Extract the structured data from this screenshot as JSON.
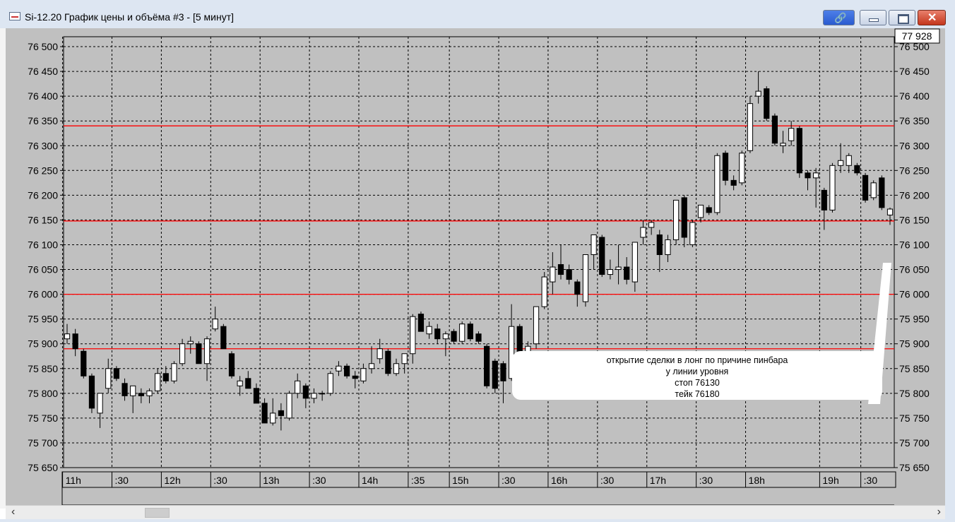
{
  "window": {
    "title": "Si-12.20 График цены и объёма #3 - [5 минут]"
  },
  "price_box": "77 928",
  "annotation": {
    "lines": [
      "открытие сделки в лонг по причине пинбара",
      "у линии уровня",
      "стоп  76130",
      "тейк 76180"
    ]
  },
  "colors": {
    "background": "#c0c0c0",
    "grid": "#000000",
    "level_line": "#ff0000",
    "bull_candle": "#ffffff",
    "bear_candle": "#000000"
  },
  "chart_data": {
    "type": "candlestick",
    "ylim": [
      75650,
      76520
    ],
    "yticks": [
      75650,
      75700,
      75750,
      75800,
      75850,
      75900,
      75950,
      76000,
      76050,
      76100,
      76150,
      76200,
      76250,
      76300,
      76350,
      76400,
      76450,
      76500
    ],
    "ytick_labels": [
      "75 650",
      "75 700",
      "75 750",
      "75 800",
      "75 850",
      "75 900",
      "75 950",
      "76 000",
      "76 050",
      "76 100",
      "76 150",
      "76 200",
      "76 250",
      "76 300",
      "76 350",
      "76 400",
      "76 450",
      "76 500"
    ],
    "time_labels": [
      "11h",
      ":30",
      "12h",
      ":30",
      "13h",
      ":30",
      "14h",
      ":35",
      "15h",
      ":30",
      "16h",
      ":30",
      "17h",
      ":30",
      "18h",
      "19h",
      ":30"
    ],
    "time_label_slots": [
      0,
      6,
      12,
      18,
      24,
      30,
      36,
      42,
      47,
      53,
      59,
      65,
      71,
      77,
      83,
      92,
      97
    ],
    "grid": true,
    "horizontal_levels": [
      76340,
      76148,
      76000,
      75890
    ],
    "candles": [
      {
        "o": 75910,
        "h": 75940,
        "l": 75900,
        "c": 75920
      },
      {
        "o": 75920,
        "h": 75930,
        "l": 75875,
        "c": 75890
      },
      {
        "o": 75885,
        "h": 75890,
        "l": 75830,
        "c": 75835
      },
      {
        "o": 75835,
        "h": 75840,
        "l": 75760,
        "c": 75770
      },
      {
        "o": 75760,
        "h": 75800,
        "l": 75730,
        "c": 75800
      },
      {
        "o": 75810,
        "h": 75870,
        "l": 75800,
        "c": 75850
      },
      {
        "o": 75850,
        "h": 75855,
        "l": 75825,
        "c": 75830
      },
      {
        "o": 75820,
        "h": 75830,
        "l": 75785,
        "c": 75795
      },
      {
        "o": 75795,
        "h": 75815,
        "l": 75760,
        "c": 75815
      },
      {
        "o": 75800,
        "h": 75810,
        "l": 75780,
        "c": 75795
      },
      {
        "o": 75795,
        "h": 75810,
        "l": 75780,
        "c": 75805
      },
      {
        "o": 75805,
        "h": 75850,
        "l": 75800,
        "c": 75840
      },
      {
        "o": 75840,
        "h": 75855,
        "l": 75820,
        "c": 75825
      },
      {
        "o": 75825,
        "h": 75865,
        "l": 75820,
        "c": 75860
      },
      {
        "o": 75860,
        "h": 75910,
        "l": 75855,
        "c": 75900
      },
      {
        "o": 75900,
        "h": 75915,
        "l": 75880,
        "c": 75905
      },
      {
        "o": 75900,
        "h": 75905,
        "l": 75860,
        "c": 75860
      },
      {
        "o": 75860,
        "h": 75915,
        "l": 75825,
        "c": 75910
      },
      {
        "o": 75930,
        "h": 75975,
        "l": 75925,
        "c": 75950
      },
      {
        "o": 75935,
        "h": 75940,
        "l": 75890,
        "c": 75890
      },
      {
        "o": 75880,
        "h": 75885,
        "l": 75830,
        "c": 75835
      },
      {
        "o": 75815,
        "h": 75835,
        "l": 75795,
        "c": 75825
      },
      {
        "o": 75830,
        "h": 75845,
        "l": 75810,
        "c": 75810
      },
      {
        "o": 75810,
        "h": 75820,
        "l": 75780,
        "c": 75780
      },
      {
        "o": 75780,
        "h": 75790,
        "l": 75740,
        "c": 75740
      },
      {
        "o": 75740,
        "h": 75790,
        "l": 75735,
        "c": 75760
      },
      {
        "o": 75765,
        "h": 75780,
        "l": 75725,
        "c": 75755
      },
      {
        "o": 75750,
        "h": 75805,
        "l": 75745,
        "c": 75800
      },
      {
        "o": 75800,
        "h": 75840,
        "l": 75790,
        "c": 75825
      },
      {
        "o": 75815,
        "h": 75820,
        "l": 75770,
        "c": 75790
      },
      {
        "o": 75790,
        "h": 75810,
        "l": 75780,
        "c": 75800
      },
      {
        "o": 75800,
        "h": 75805,
        "l": 75785,
        "c": 75800
      },
      {
        "o": 75800,
        "h": 75845,
        "l": 75795,
        "c": 75840
      },
      {
        "o": 75845,
        "h": 75865,
        "l": 75835,
        "c": 75855
      },
      {
        "o": 75855,
        "h": 75860,
        "l": 75830,
        "c": 75835
      },
      {
        "o": 75835,
        "h": 75845,
        "l": 75810,
        "c": 75830
      },
      {
        "o": 75825,
        "h": 75860,
        "l": 75820,
        "c": 75850
      },
      {
        "o": 75850,
        "h": 75895,
        "l": 75840,
        "c": 75860
      },
      {
        "o": 75870,
        "h": 75910,
        "l": 75860,
        "c": 75890
      },
      {
        "o": 75885,
        "h": 75890,
        "l": 75835,
        "c": 75840
      },
      {
        "o": 75840,
        "h": 75870,
        "l": 75835,
        "c": 75860
      },
      {
        "o": 75860,
        "h": 75875,
        "l": 75840,
        "c": 75880
      },
      {
        "o": 75880,
        "h": 75960,
        "l": 75860,
        "c": 75955
      },
      {
        "o": 75960,
        "h": 75965,
        "l": 75925,
        "c": 75925
      },
      {
        "o": 75920,
        "h": 75945,
        "l": 75910,
        "c": 75935
      },
      {
        "o": 75930,
        "h": 75940,
        "l": 75900,
        "c": 75910
      },
      {
        "o": 75910,
        "h": 75925,
        "l": 75875,
        "c": 75920
      },
      {
        "o": 75925,
        "h": 75930,
        "l": 75900,
        "c": 75905
      },
      {
        "o": 75905,
        "h": 75945,
        "l": 75900,
        "c": 75940
      },
      {
        "o": 75940,
        "h": 75945,
        "l": 75905,
        "c": 75910
      },
      {
        "o": 75920,
        "h": 75925,
        "l": 75900,
        "c": 75905
      },
      {
        "o": 75895,
        "h": 75900,
        "l": 75810,
        "c": 75815
      },
      {
        "o": 75865,
        "h": 75870,
        "l": 75800,
        "c": 75810
      },
      {
        "o": 75860,
        "h": 75865,
        "l": 75780,
        "c": 75825
      },
      {
        "o": 75830,
        "h": 75980,
        "l": 75825,
        "c": 75935
      },
      {
        "o": 75935,
        "h": 75940,
        "l": 75870,
        "c": 75875
      },
      {
        "o": 75875,
        "h": 75905,
        "l": 75860,
        "c": 75895
      },
      {
        "o": 75900,
        "h": 75975,
        "l": 75890,
        "c": 75975
      },
      {
        "o": 75975,
        "h": 76045,
        "l": 75970,
        "c": 76035
      },
      {
        "o": 76025,
        "h": 76085,
        "l": 76000,
        "c": 76055
      },
      {
        "o": 76060,
        "h": 76100,
        "l": 76030,
        "c": 76040
      },
      {
        "o": 76050,
        "h": 76060,
        "l": 76020,
        "c": 76030
      },
      {
        "o": 76025,
        "h": 76030,
        "l": 75975,
        "c": 76000
      },
      {
        "o": 75985,
        "h": 76075,
        "l": 75975,
        "c": 76080
      },
      {
        "o": 76080,
        "h": 76120,
        "l": 76050,
        "c": 76120
      },
      {
        "o": 76115,
        "h": 76120,
        "l": 76035,
        "c": 76040
      },
      {
        "o": 76040,
        "h": 76070,
        "l": 76030,
        "c": 76050
      },
      {
        "o": 76050,
        "h": 76100,
        "l": 76020,
        "c": 76055
      },
      {
        "o": 76055,
        "h": 76075,
        "l": 76020,
        "c": 76030
      },
      {
        "o": 76025,
        "h": 76105,
        "l": 76005,
        "c": 76105
      },
      {
        "o": 76115,
        "h": 76150,
        "l": 76100,
        "c": 76135
      },
      {
        "o": 76135,
        "h": 76150,
        "l": 76120,
        "c": 76145
      },
      {
        "o": 76120,
        "h": 76130,
        "l": 76045,
        "c": 76080
      },
      {
        "o": 76080,
        "h": 76120,
        "l": 76065,
        "c": 76110
      },
      {
        "o": 76110,
        "h": 76190,
        "l": 76100,
        "c": 76190
      },
      {
        "o": 76195,
        "h": 76200,
        "l": 76095,
        "c": 76115
      },
      {
        "o": 76100,
        "h": 76150,
        "l": 76095,
        "c": 76145
      },
      {
        "o": 76155,
        "h": 76180,
        "l": 76145,
        "c": 76180
      },
      {
        "o": 76175,
        "h": 76180,
        "l": 76160,
        "c": 76165
      },
      {
        "o": 76165,
        "h": 76285,
        "l": 76160,
        "c": 76280
      },
      {
        "o": 76285,
        "h": 76290,
        "l": 76220,
        "c": 76230
      },
      {
        "o": 76230,
        "h": 76240,
        "l": 76210,
        "c": 76220
      },
      {
        "o": 76225,
        "h": 76290,
        "l": 76220,
        "c": 76285
      },
      {
        "o": 76290,
        "h": 76400,
        "l": 76285,
        "c": 76385
      },
      {
        "o": 76400,
        "h": 76450,
        "l": 76385,
        "c": 76410
      },
      {
        "o": 76415,
        "h": 76420,
        "l": 76350,
        "c": 76355
      },
      {
        "o": 76360,
        "h": 76365,
        "l": 76300,
        "c": 76305
      },
      {
        "o": 76300,
        "h": 76330,
        "l": 76285,
        "c": 76305
      },
      {
        "o": 76310,
        "h": 76350,
        "l": 76300,
        "c": 76335
      },
      {
        "o": 76335,
        "h": 76340,
        "l": 76235,
        "c": 76245
      },
      {
        "o": 76245,
        "h": 76250,
        "l": 76210,
        "c": 76235
      },
      {
        "o": 76235,
        "h": 76255,
        "l": 76175,
        "c": 76245
      },
      {
        "o": 76210,
        "h": 76215,
        "l": 76130,
        "c": 76170
      },
      {
        "o": 76170,
        "h": 76265,
        "l": 76165,
        "c": 76260
      },
      {
        "o": 76260,
        "h": 76305,
        "l": 76245,
        "c": 76270
      },
      {
        "o": 76260,
        "h": 76285,
        "l": 76245,
        "c": 76280
      },
      {
        "o": 76260,
        "h": 76265,
        "l": 76240,
        "c": 76245
      },
      {
        "o": 76240,
        "h": 76245,
        "l": 76185,
        "c": 76190
      },
      {
        "o": 76195,
        "h": 76230,
        "l": 76190,
        "c": 76225
      },
      {
        "o": 76235,
        "h": 76240,
        "l": 76170,
        "c": 76175
      },
      {
        "o": 76160,
        "h": 76175,
        "l": 76140,
        "c": 76172
      }
    ]
  }
}
